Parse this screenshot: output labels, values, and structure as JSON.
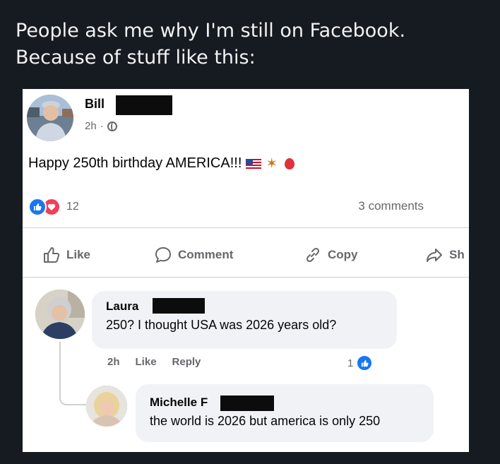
{
  "caption": {
    "line1": "People ask me why I'm still on Facebook.",
    "line2": "Because of stuff like this:"
  },
  "post": {
    "author": "Bill",
    "time": "2h",
    "separator": "·",
    "text": "Happy 250th birthday AMERICA!!!",
    "emojis": [
      "flag-us-icon",
      "party-popper-icon",
      "balloon-icon"
    ],
    "reaction_count": "12",
    "comments_count": "3 comments"
  },
  "actions": {
    "like": "Like",
    "comment": "Comment",
    "copy": "Copy",
    "share": "Sh"
  },
  "comments": [
    {
      "author": "Laura",
      "text": "250? I thought USA was 2026 years old?",
      "time": "2h",
      "like": "Like",
      "reply": "Reply",
      "reactions": "1"
    },
    {
      "author": "Michelle",
      "initial": "F",
      "text": "the world is 2026 but america is only 250"
    }
  ],
  "colors": {
    "background": "#161b22",
    "card": "#ffffff",
    "like_blue": "#1877f2",
    "love_red": "#f33e58",
    "muted": "#65676b",
    "bubble": "#f0f2f5"
  }
}
